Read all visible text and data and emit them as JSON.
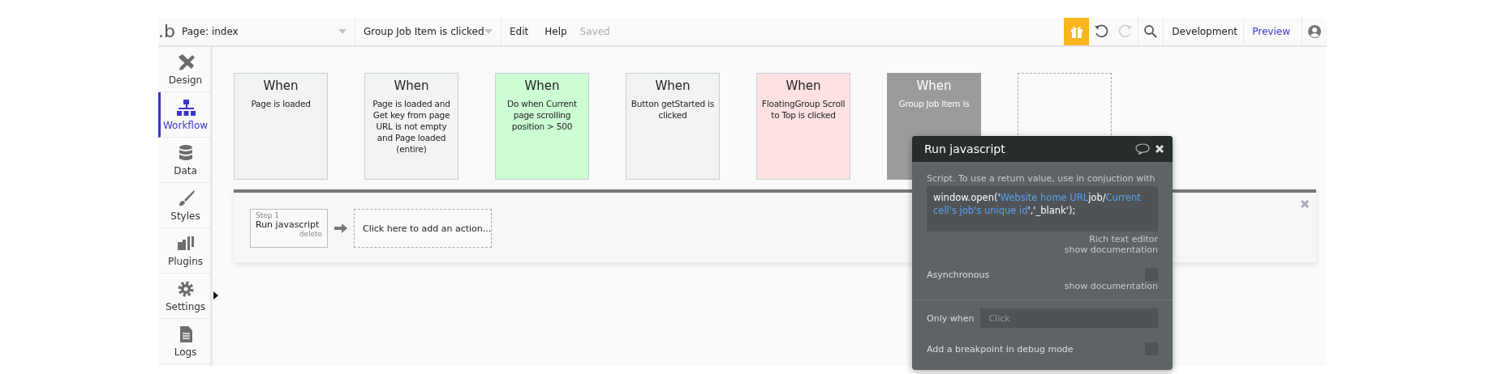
{
  "topbar": {
    "logo": ".b",
    "page_selector": "Page: index",
    "workflow_selector": "Group Job Item is clicked",
    "menu": [
      "Edit",
      "Help"
    ],
    "save_status": "Saved",
    "redo_disabled": true,
    "version": "Development",
    "preview": "Preview"
  },
  "sidebar": {
    "items": [
      {
        "label": "Design",
        "selected": false
      },
      {
        "label": "Workflow",
        "selected": true
      },
      {
        "label": "Data",
        "selected": false
      },
      {
        "label": "Styles",
        "selected": false
      },
      {
        "label": "Plugins",
        "selected": false
      },
      {
        "label": "Settings",
        "selected": false
      },
      {
        "label": "Logs",
        "selected": false
      }
    ]
  },
  "events": [
    {
      "title": "When",
      "description": "Page is loaded",
      "color": "#f2f3f3",
      "selected": false
    },
    {
      "title": "When",
      "description": "Page is loaded and Get key from page URL is not empty and Page loaded (entire)",
      "color": "#f2f3f3",
      "selected": false
    },
    {
      "title": "When",
      "description": "Do when Current page scrolling position > 500",
      "color": "#ccfdd3",
      "selected": false
    },
    {
      "title": "When",
      "description": "Button getStarted is clicked",
      "color": "#f2f3f3",
      "selected": false
    },
    {
      "title": "When",
      "description": "FloatingGroup Scroll to Top is clicked",
      "color": "#fee1e2",
      "selected": false
    },
    {
      "title": "When",
      "description": "Group Job Item is",
      "color": "#9b9b9b",
      "selected": true
    }
  ],
  "actions": {
    "steps": [
      {
        "step": "Step 1",
        "name": "Run javascript",
        "delete": "delete"
      }
    ],
    "add_action": "Click here to add an action..."
  },
  "popup": {
    "title": "Run javascript",
    "script_label": "Script. To use a return value, use in conjuction with",
    "script": [
      {
        "kind": "plain",
        "text": "window.open('"
      },
      {
        "kind": "dynamic",
        "text": "Website home URL"
      },
      {
        "kind": "plain",
        "text": "job/"
      },
      {
        "kind": "dynamic",
        "text": "Current cell's job's unique id"
      },
      {
        "kind": "plain",
        "text": "','_blank');"
      }
    ],
    "rich_text_editor": "Rich text editor",
    "show_documentation": "show documentation",
    "asynchronous": {
      "label": "Asynchronous",
      "checked": false,
      "doc": "show documentation"
    },
    "only_when": {
      "label": "Only when",
      "placeholder": "Click"
    },
    "breakpoint": {
      "label": "Add a breakpoint in debug mode",
      "checked": false
    }
  }
}
